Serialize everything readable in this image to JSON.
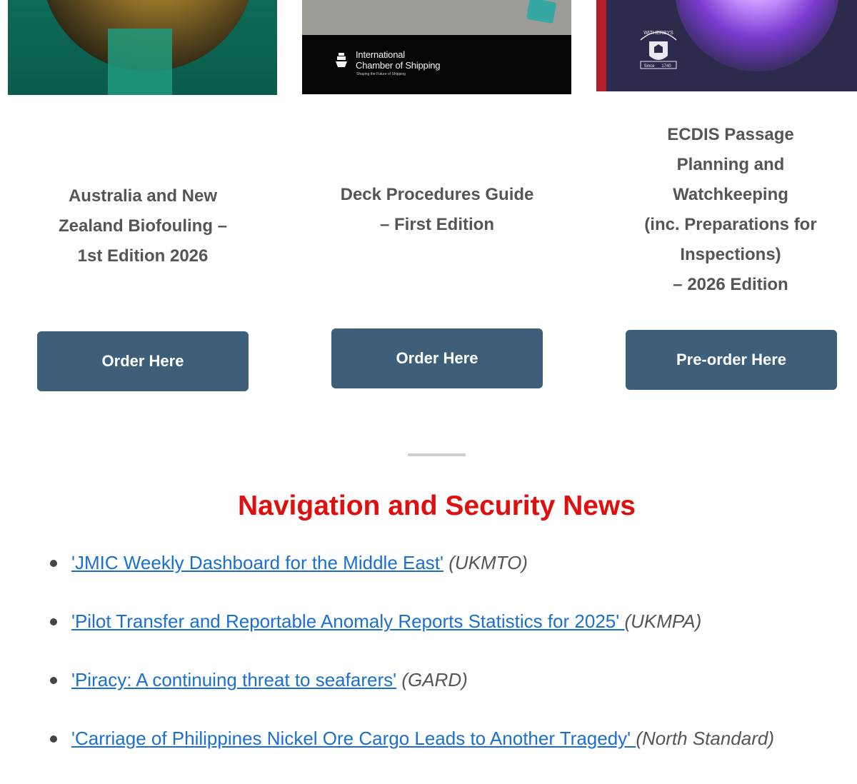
{
  "books": [
    {
      "title": "Australia and New\nZealand Biofouling –\n1st Edition 2026",
      "button_label": "Order Here",
      "cover_icon": "biofouling-cover-image"
    },
    {
      "title": "Deck Procedures Guide\n– First Edition",
      "button_label": "Order Here",
      "cover_icon": "deck-procedures-cover-image",
      "cover_publisher_line1": "International",
      "cover_publisher_line2": "Chamber of Shipping",
      "cover_tagline": "Shaping the Future of Shipping"
    },
    {
      "title": "ECDIS Passage\nPlanning and\nWatchkeeping\n(inc. Preparations for\nInspections)\n– 2026 Edition",
      "button_label": "Pre-order Here",
      "cover_icon": "ecdis-cover-image",
      "cover_crest_text": "WITHERBYS",
      "cover_crest_since": "Since",
      "cover_crest_year": "1740"
    }
  ],
  "news": {
    "heading": "Navigation and Security News",
    "items": [
      {
        "link_text": "'JMIC Weekly Dashboard for the Middle East'",
        "source": "(UKMTO)"
      },
      {
        "link_text": "'Pilot Transfer and Reportable Anomaly Reports Statistics for 2025' ",
        "source": "(UKMPA)"
      },
      {
        "link_text": "'Piracy: A continuing threat to seafarers'",
        "source": "(GARD)"
      },
      {
        "link_text": "'Carriage of Philippines Nickel Ore Cargo Leads to Another Tragedy' ",
        "source": "(North Standard)"
      }
    ]
  },
  "colors": {
    "heading_red": "#e00e0e",
    "button_blue": "#3e5f7a",
    "link_blue": "#1a6fd1",
    "text_gray": "#555555"
  }
}
